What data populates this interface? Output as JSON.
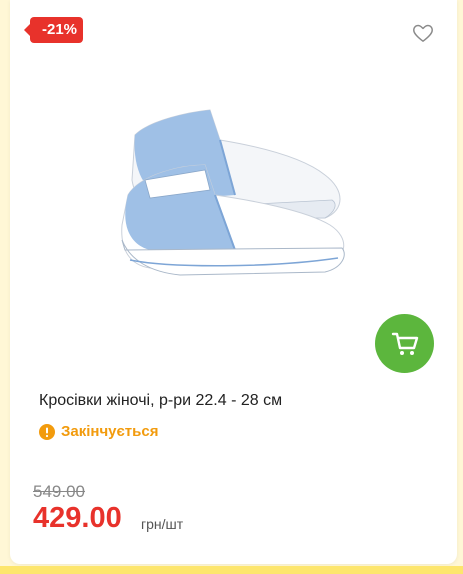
{
  "badge": {
    "discount": "-21%"
  },
  "product": {
    "title": "Кросівки жіночі, р-ри 22.4 - 28 см",
    "status": "Закінчується",
    "old_price": "549.00",
    "price": "429.00",
    "unit": "грн/шт"
  },
  "icons": {
    "favorite": "heart-outline-icon",
    "cart": "cart-icon",
    "status": "alert-circle-icon"
  },
  "colors": {
    "discount": "#e8322b",
    "cart_button": "#5cb63d",
    "status": "#f29b0d",
    "price": "#e8322b"
  }
}
